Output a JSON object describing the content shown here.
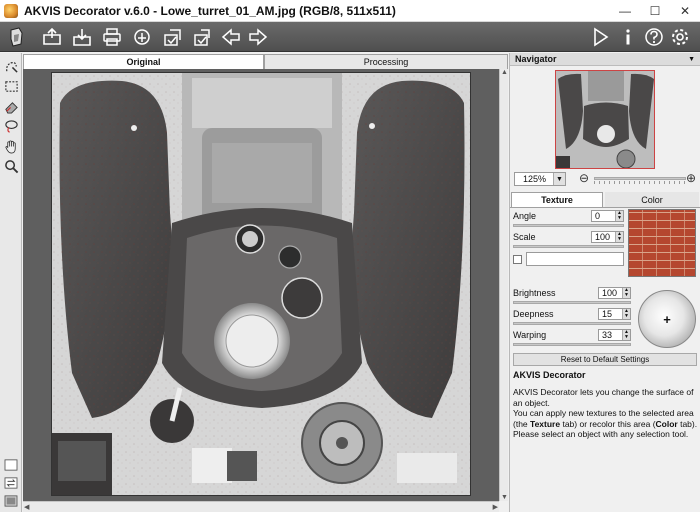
{
  "window": {
    "title": "AKVIS Decorator v.6.0 - Lowe_turret_01_AM.jpg (RGB/8, 511x511)"
  },
  "canvas_tabs": [
    {
      "label": "Original",
      "active": true
    },
    {
      "label": "Processing",
      "active": false
    }
  ],
  "navigator": {
    "title": "Navigator",
    "zoom": "125%"
  },
  "panel_tabs": [
    {
      "label": "Texture",
      "active": true
    },
    {
      "label": "Color",
      "active": false
    }
  ],
  "params": {
    "angle": {
      "label": "Angle",
      "value": "0"
    },
    "scale": {
      "label": "Scale",
      "value": "100"
    },
    "brightness": {
      "label": "Brightness",
      "value": "100"
    },
    "deepness": {
      "label": "Deepness",
      "value": "15"
    },
    "warping": {
      "label": "Warping",
      "value": "33"
    }
  },
  "reset_label": "Reset to Default Settings",
  "help": {
    "title": "AKVIS Decorator",
    "line1": "AKVIS Decorator lets you change the surface of an object.",
    "line2a": "You can apply new textures to the selected area (the ",
    "texture_word": "Texture",
    "line2b": " tab) or recolor this area (",
    "color_word": "Color",
    "line2c": " tab).",
    "line3": "Please select an object with any selection tool."
  },
  "colors": {
    "accent": "#3a6fc4",
    "toolbar": "#5a5a5a",
    "brick": "#b5472f"
  },
  "icons": {
    "toolbar_left": [
      "akvis-logo-icon",
      "open-icon",
      "save-icon",
      "print-icon",
      "share-icon",
      "batch-icon",
      "preferences-icon",
      "undo-icon",
      "redo-icon"
    ],
    "toolbar_right": [
      "run-icon",
      "info-icon",
      "help-icon",
      "settings-icon"
    ],
    "tools": [
      "magic-brush-icon",
      "rect-selection-icon",
      "eraser-icon",
      "lasso-icon",
      "hand-icon",
      "zoom-icon"
    ]
  }
}
